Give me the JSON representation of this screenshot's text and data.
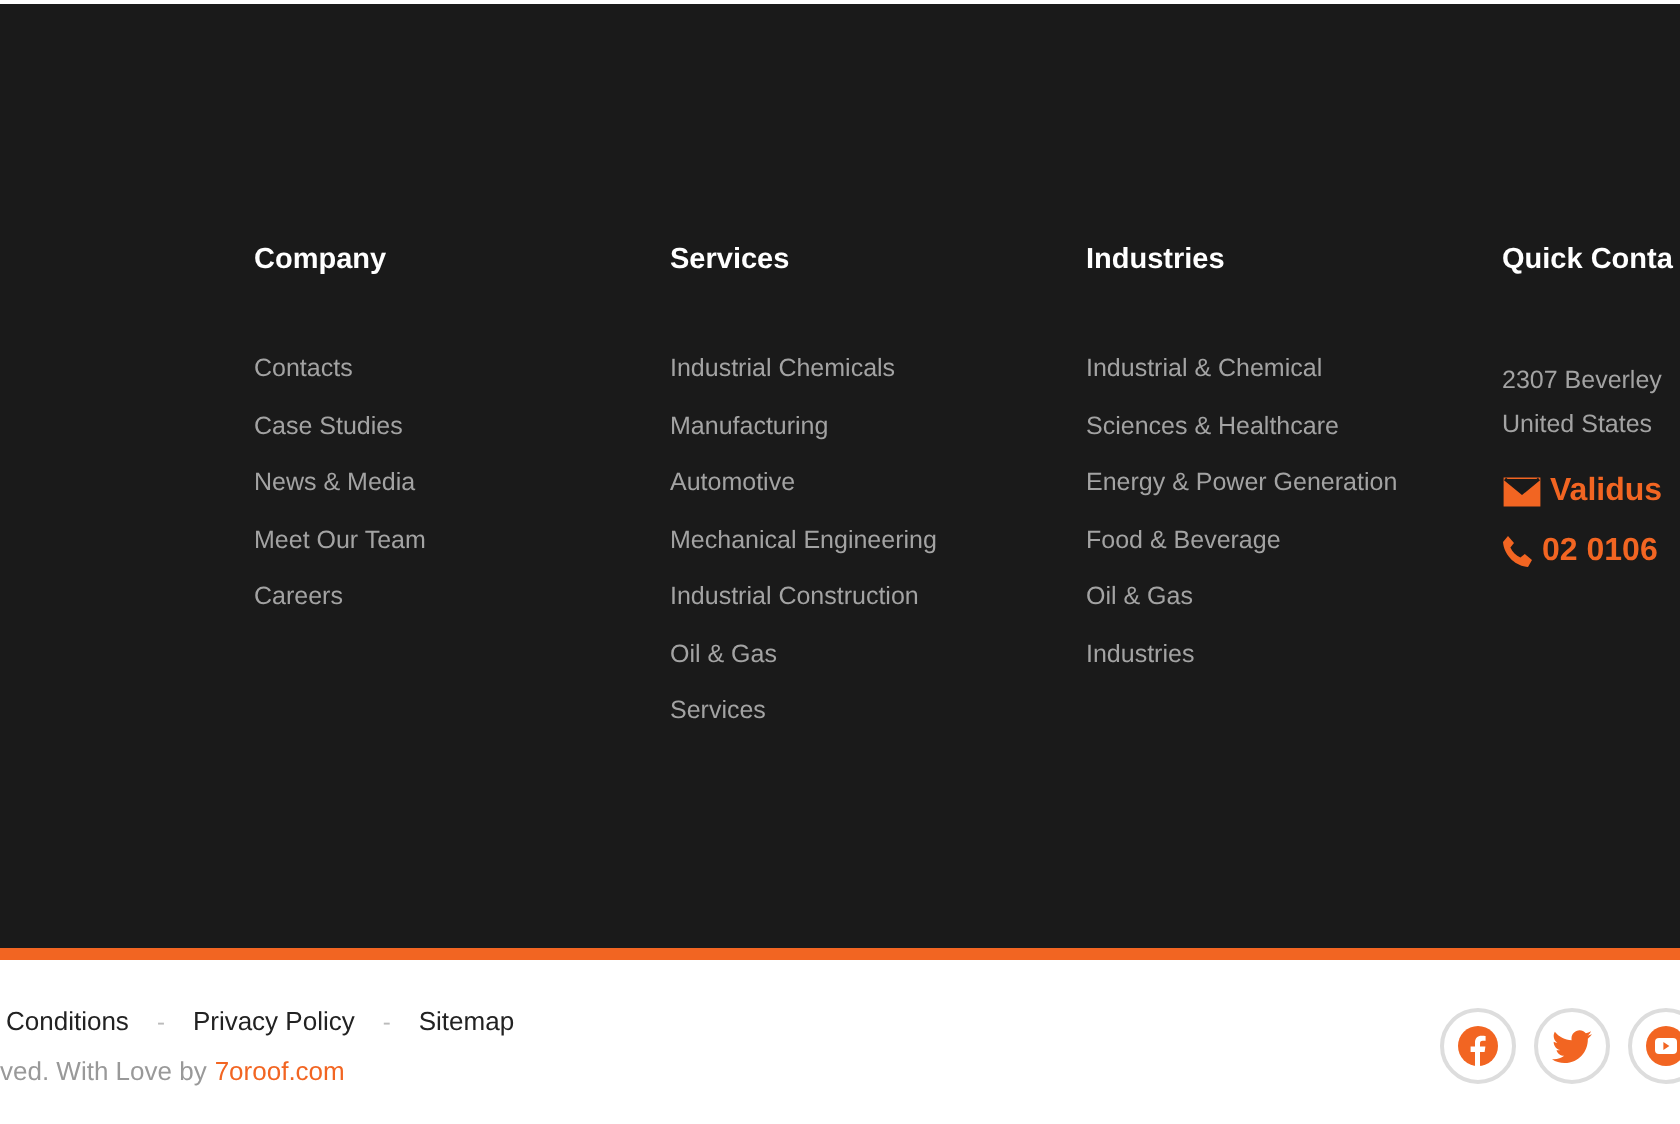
{
  "columns": [
    {
      "kind": "links",
      "title": "Company",
      "links": [
        "Contacts",
        "Case Studies",
        "News & Media",
        "Meet Our Team",
        "Careers"
      ]
    },
    {
      "kind": "links",
      "title": "Services",
      "links": [
        "Industrial Chemicals",
        "Manufacturing",
        "Automotive",
        "Mechanical Engineering",
        "Industrial Construction",
        "Oil & Gas",
        "Services"
      ]
    },
    {
      "kind": "links",
      "title": "Industries",
      "links": [
        "Industrial & Chemical",
        "Sciences & Healthcare",
        "Energy & Power Generation",
        "Food & Beverage",
        "Oil & Gas",
        "Industries"
      ]
    },
    {
      "kind": "contact",
      "title": "Quick Conta",
      "address": [
        "2307 Beverley",
        "United States"
      ],
      "email": "Validus",
      "phone": "02 0106"
    }
  ],
  "bottom_links": [
    "Conditions",
    "Privacy Policy",
    "Sitemap"
  ],
  "link_separator": "-",
  "copyright": "ved. With Love by",
  "credit_link": "7oroof.com",
  "social": [
    {
      "kind": "facebook"
    },
    {
      "kind": "twitter"
    },
    {
      "kind": "youtube"
    }
  ]
}
